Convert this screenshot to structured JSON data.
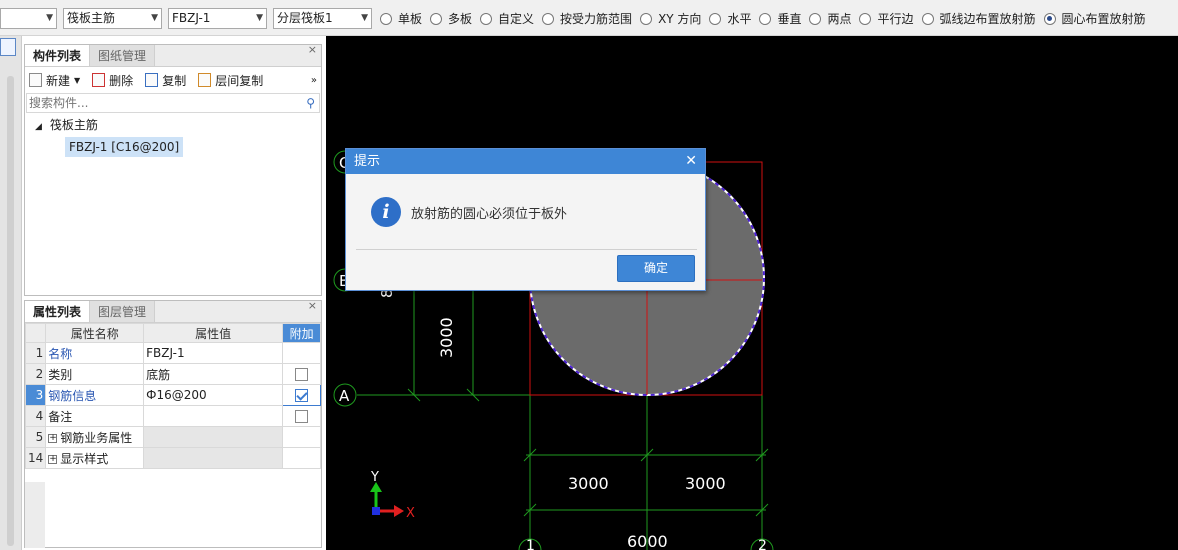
{
  "toolbar": {
    "combo0": "",
    "combo1": "筏板主筋",
    "combo2": "FBZJ-1",
    "combo3": "分层筏板1",
    "radios": [
      "单板",
      "多板",
      "自定义",
      "按受力筋范围",
      "XY 方向",
      "水平",
      "垂直",
      "两点",
      "平行边",
      "弧线边布置放射筋",
      "圆心布置放射筋"
    ],
    "selected_radio": "圆心布置放射筋"
  },
  "component_panel": {
    "tab_active": "构件列表",
    "tab_inactive": "图纸管理",
    "buttons": {
      "new": "新建",
      "delete": "删除",
      "copy": "复制",
      "floor_copy": "层间复制"
    },
    "search_placeholder": "搜索构件...",
    "tree_root": "筏板主筋",
    "tree_child": "FBZJ-1 [C16@200]"
  },
  "property_panel": {
    "tab_active": "属性列表",
    "tab_inactive": "图层管理",
    "headers": {
      "name": "属性名称",
      "value": "属性值",
      "extra": "附加"
    },
    "rows": [
      {
        "no": "1",
        "name": "名称",
        "value": "FBZJ-1",
        "check": null
      },
      {
        "no": "2",
        "name": "类别",
        "value": "底筋",
        "check": false
      },
      {
        "no": "3",
        "name": "钢筋信息",
        "value": "Ф16@200",
        "check": true
      },
      {
        "no": "4",
        "name": "备注",
        "value": "",
        "check": false
      },
      {
        "no": "5",
        "name": "钢筋业务属性",
        "value": "",
        "check": null
      },
      {
        "no": "14",
        "name": "显示样式",
        "value": "",
        "check": null
      }
    ]
  },
  "cad": {
    "axis_labels": {
      "C": "C",
      "B": "B",
      "A": "A",
      "n1": "1",
      "n2": "2"
    },
    "dims": {
      "v3000": "3000",
      "h3000a": "3000",
      "h3000b": "3000",
      "h6000": "6000",
      "b": "8"
    },
    "ucs": {
      "x": "X",
      "y": "Y"
    }
  },
  "dialog": {
    "title": "提示",
    "message": "放射筋的圆心必须位于板外",
    "ok": "确定"
  }
}
